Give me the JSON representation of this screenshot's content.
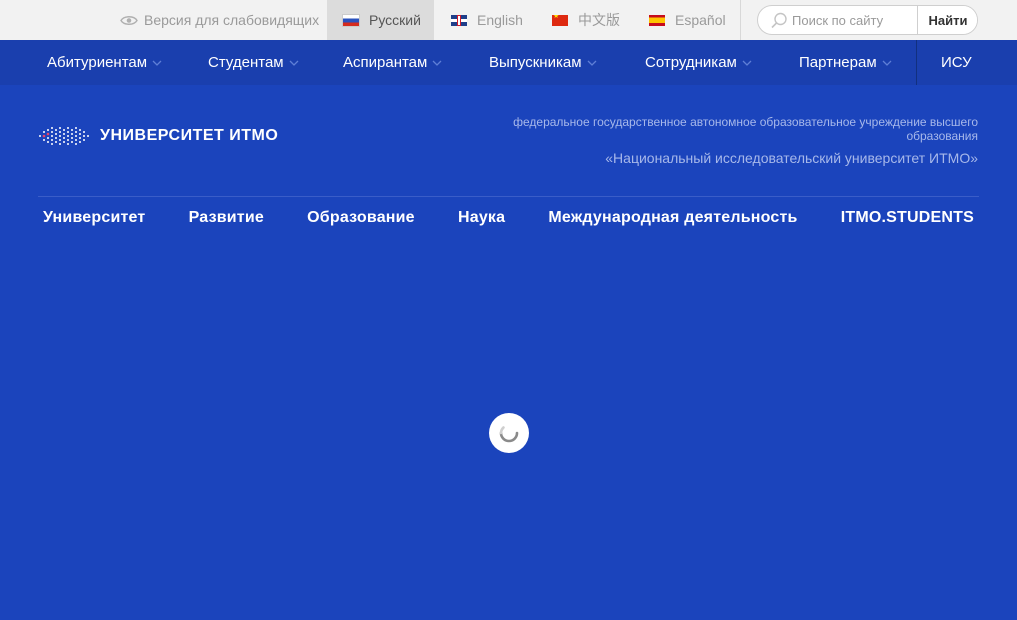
{
  "topbar": {
    "accessibility_label": "Версия для слабовидящих",
    "languages": [
      {
        "label": "Русский",
        "flag": "ru-flag-icon",
        "active": true
      },
      {
        "label": "English",
        "flag": "gb-flag-icon",
        "active": false
      },
      {
        "label": "中文版",
        "flag": "cn-flag-icon",
        "active": false
      },
      {
        "label": "Español",
        "flag": "es-flag-icon",
        "active": false
      }
    ],
    "search": {
      "placeholder": "Поиск по сайту",
      "value": "",
      "button_label": "Найти"
    }
  },
  "audience_nav": {
    "items": [
      {
        "label": "Абитуриентам"
      },
      {
        "label": "Студентам"
      },
      {
        "label": "Аспирантам"
      },
      {
        "label": "Выпускникам"
      },
      {
        "label": "Сотрудникам"
      },
      {
        "label": "Партнерам"
      },
      {
        "label": "ИСУ"
      }
    ]
  },
  "header": {
    "logo_text": "УНИВЕРСИТЕТ ИТМО",
    "federal_status": "федеральное государственное автономное образовательное учреждение высшего образования",
    "university_name": "«Национальный исследовательский университет ИТМО»"
  },
  "main_nav": {
    "items": [
      {
        "label": "Университет"
      },
      {
        "label": "Развитие"
      },
      {
        "label": "Образование"
      },
      {
        "label": "Наука"
      },
      {
        "label": "Международная деятельность"
      },
      {
        "label": "ITMO.STUDENTS"
      }
    ]
  },
  "colors": {
    "background": "#1b44bc",
    "nav_background": "#1a3fae",
    "topbar_background": "#f2f2f2",
    "muted_text": "#a7b8ea"
  }
}
